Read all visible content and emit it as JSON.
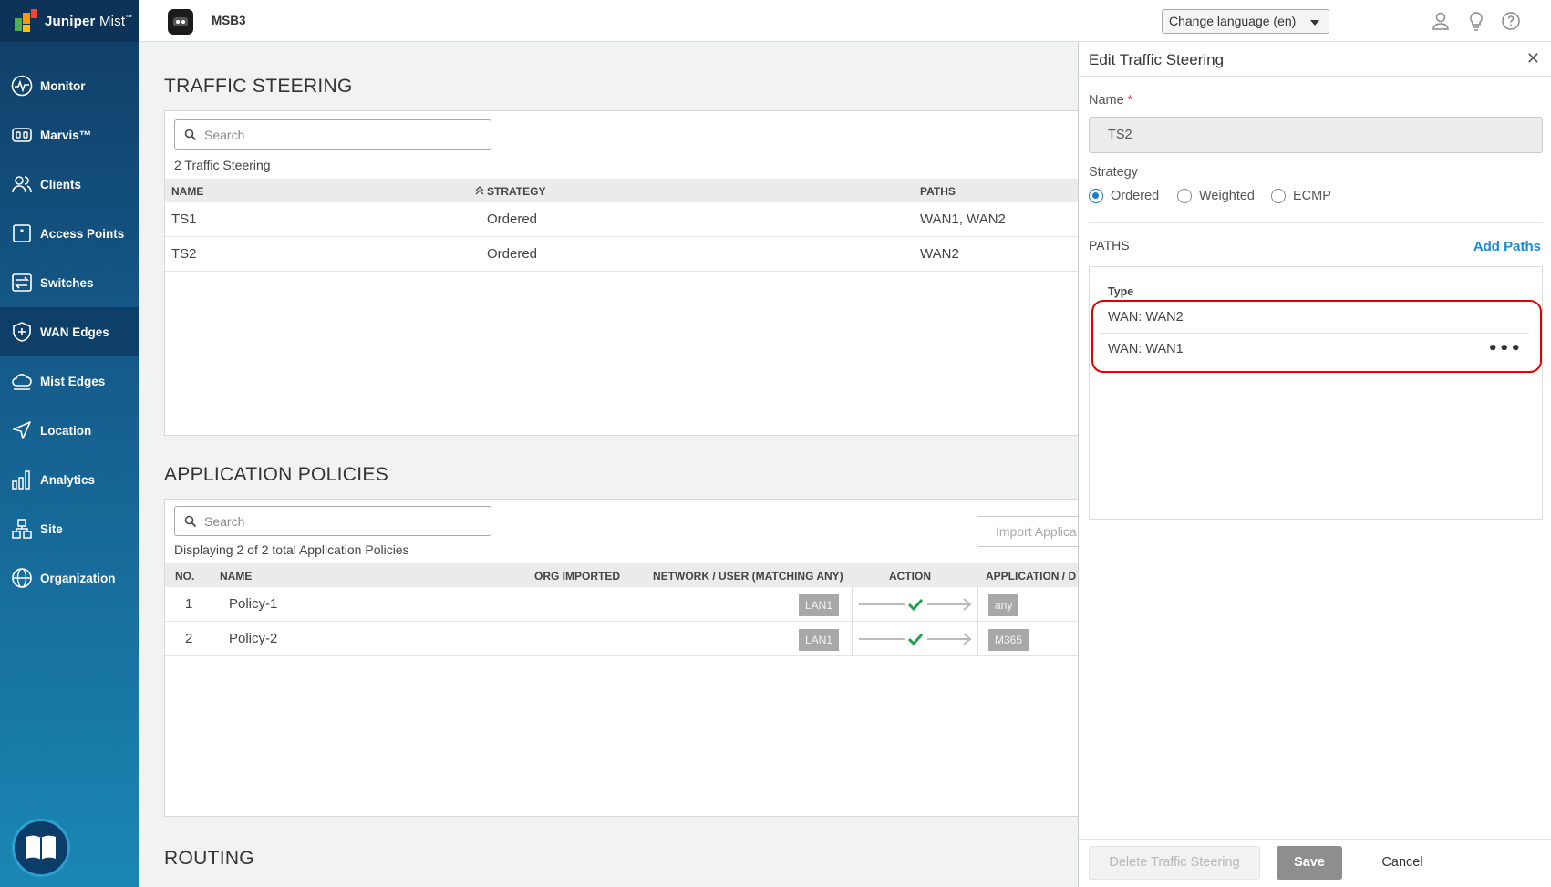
{
  "brand": {
    "name": "Juniper",
    "suffix": "Mist",
    "tm": "™"
  },
  "sidebar": {
    "items": [
      {
        "label": "Monitor",
        "icon": "monitor-icon"
      },
      {
        "label": "Marvis™",
        "icon": "marvis-icon"
      },
      {
        "label": "Clients",
        "icon": "clients-icon"
      },
      {
        "label": "Access Points",
        "icon": "access-point-icon"
      },
      {
        "label": "Switches",
        "icon": "switch-icon"
      },
      {
        "label": "WAN Edges",
        "icon": "wan-edge-icon",
        "active": true
      },
      {
        "label": "Mist Edges",
        "icon": "cloud-icon"
      },
      {
        "label": "Location",
        "icon": "location-icon"
      },
      {
        "label": "Analytics",
        "icon": "analytics-icon"
      },
      {
        "label": "Site",
        "icon": "site-icon"
      },
      {
        "label": "Organization",
        "icon": "globe-icon"
      }
    ]
  },
  "topbar": {
    "site_name": "MSB3",
    "language_button": "Change language (en)"
  },
  "traffic_steering": {
    "title": "TRAFFIC STEERING",
    "search_placeholder": "Search",
    "count_text": "2 Traffic Steering",
    "columns": {
      "name": "NAME",
      "strategy": "STRATEGY",
      "paths": "PATHS"
    },
    "rows": [
      {
        "name": "TS1",
        "strategy": "Ordered",
        "paths": "WAN1, WAN2"
      },
      {
        "name": "TS2",
        "strategy": "Ordered",
        "paths": "WAN2"
      }
    ]
  },
  "application_policies": {
    "title": "APPLICATION POLICIES",
    "search_placeholder": "Search",
    "count_text": "Displaying 2 of 2 total Application Policies",
    "import_button": "Import Applica",
    "columns": {
      "no": "NO.",
      "name": "NAME",
      "org_imported": "ORG IMPORTED",
      "network_user": "NETWORK / USER (MATCHING ANY)",
      "action": "ACTION",
      "application": "APPLICATION / D"
    },
    "rows": [
      {
        "no": "1",
        "name": "Policy-1",
        "network": "LAN1",
        "application": "any"
      },
      {
        "no": "2",
        "name": "Policy-2",
        "network": "LAN1",
        "application": "M365"
      }
    ]
  },
  "routing": {
    "title": "ROUTING"
  },
  "panel": {
    "title": "Edit Traffic Steering",
    "name_label": "Name",
    "required_mark": "*",
    "name_value": "TS2",
    "strategy_label": "Strategy",
    "strategy_options": [
      "Ordered",
      "Weighted",
      "ECMP"
    ],
    "strategy_selected": "Ordered",
    "paths_label": "PATHS",
    "add_paths": "Add Paths",
    "type_header": "Type",
    "paths": [
      "WAN: WAN2",
      "WAN: WAN1"
    ],
    "more_label": "•••",
    "buttons": {
      "delete": "Delete Traffic Steering",
      "save": "Save",
      "cancel": "Cancel"
    }
  },
  "colors": {
    "accent": "#1a8ad8",
    "highlight": "#e00000",
    "sidebar_dark": "#0f3d66",
    "check": "#22a04b"
  }
}
